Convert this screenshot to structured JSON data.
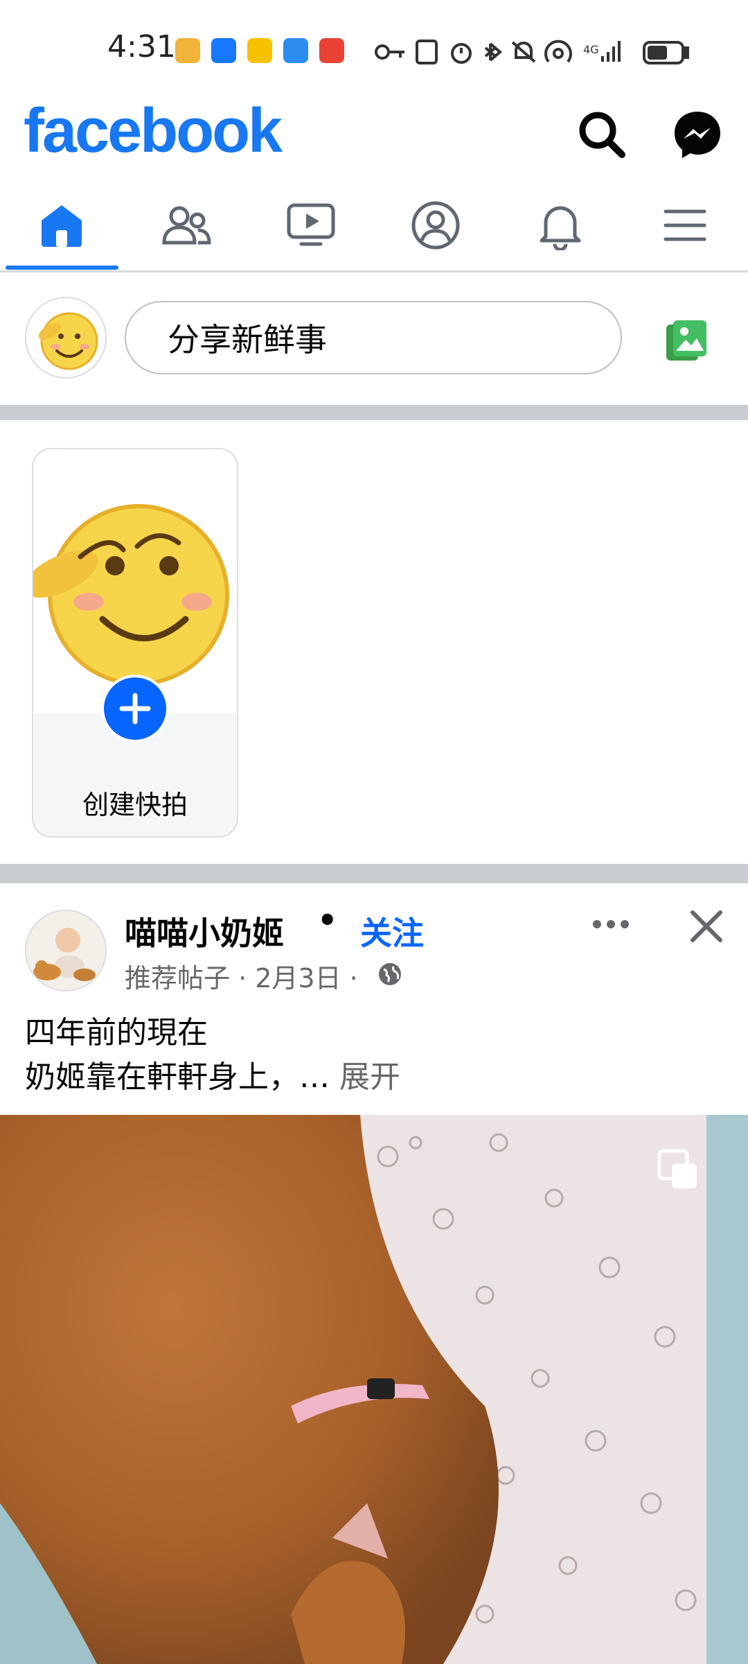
{
  "status_bar": {
    "time": "4:31",
    "icons": [
      "target-app-icon",
      "alipay-icon",
      "mail-app-icon",
      "shop-app-icon",
      "alert-app-icon",
      "key-icon",
      "nfc-icon",
      "alarm-icon",
      "bluetooth-icon",
      "mute-icon",
      "hotspot-icon",
      "signal-4g-icon",
      "battery-icon"
    ]
  },
  "header": {
    "logo": "facebook",
    "search_icon": "search-icon",
    "messenger_icon": "messenger-icon"
  },
  "nav": {
    "active": "home",
    "items": [
      "home-icon",
      "friends-icon",
      "video-icon",
      "profile-icon",
      "notifications-icon",
      "menu-icon"
    ]
  },
  "composer": {
    "placeholder": "分享新鲜事",
    "photo_icon": "photo-icon"
  },
  "story": {
    "label": "创建快拍"
  },
  "post": {
    "author": "喵喵小奶姬",
    "separator": "•",
    "follow_label": "关注",
    "meta": "推荐帖子 · 2月3日 ·",
    "text_line1": "四年前的現在",
    "text_line2": "奶姬靠在軒軒身上，…",
    "expand_label": "展开"
  },
  "colors": {
    "brand": "#1877f2",
    "link": "#0866ff",
    "secondary_text": "#65676b",
    "divider": "#c9ccd1"
  }
}
